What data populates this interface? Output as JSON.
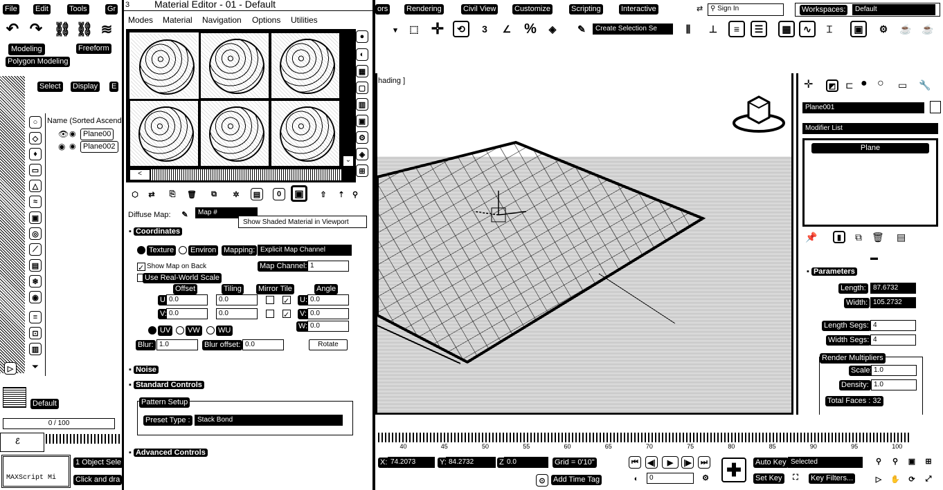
{
  "menubar": {
    "left_items": [
      "File",
      "Edit",
      "Tools",
      "Gr"
    ],
    "right_items": [
      "ors",
      "Rendering",
      "Civil View",
      "Customize",
      "Scripting",
      "Interactive"
    ],
    "sign_in": "Sign In",
    "workspaces_label": "Workspaces:",
    "workspace_value": "Default"
  },
  "ribbon": {
    "tabs": [
      "Modeling",
      "Freeform"
    ],
    "sub_label": "Polygon Modeling"
  },
  "toolbar": {
    "selection_set": "Create Selection Se"
  },
  "scene_explorer": {
    "tabs": [
      "Select",
      "Display"
    ],
    "column_header": "Name (Sorted Ascend",
    "items": [
      "Plane00",
      "Plane002"
    ],
    "layer": "Default",
    "frame_field": "0 / 100"
  },
  "material_editor": {
    "title": "Material Editor - 01 - Default",
    "title_prefix": "3",
    "menu": [
      "Modes",
      "Material",
      "Navigation",
      "Options",
      "Utilities"
    ],
    "diffuse_label": "Diffuse Map:",
    "map_name": "Map #",
    "tooltip": "Show Shaded Material in Viewport",
    "sections": {
      "coordinates": "Coordinates",
      "noise": "Noise",
      "standard_controls": "Standard Controls",
      "advanced_controls": "Advanced Controls"
    },
    "coords": {
      "texture": "Texture",
      "environ": "Environ",
      "mapping_label": "Mapping:",
      "mapping_value": "Explicit Map Channel",
      "show_map_on_back": "Show Map on Back",
      "map_channel_label": "Map Channel:",
      "map_channel_value": "1",
      "real_world": "Use Real-World Scale",
      "headers": [
        "Offset",
        "Tiling",
        "Mirror Tile",
        "Angle"
      ],
      "u_label": "U:",
      "v_label": "V:",
      "w_label": "W:",
      "offset_u": "0.0",
      "offset_v": "0.0",
      "tiling_u": "0.0",
      "tiling_v": "0.0",
      "angle_u": "0.0",
      "angle_v": "0.0",
      "angle_w": "0.0",
      "uv": "UV",
      "vw": "VW",
      "wu": "WU",
      "blur_label": "Blur:",
      "blur_value": "1.0",
      "blur_offset_label": "Blur offset:",
      "blur_offset_value": "0.0",
      "rotate": "Rotate"
    },
    "pattern_setup": "Pattern Setup",
    "preset_label": "Preset Type :",
    "preset_value": "Stack Bond"
  },
  "viewport": {
    "label": "hading ]"
  },
  "command_panel": {
    "object_name": "Plane001",
    "modifier_list": "Modifier List",
    "stack_item": "Plane",
    "parameters": "Parameters",
    "length_label": "Length:",
    "length_value": "87.6732",
    "width_label": "Width:",
    "width_value": "105.2732",
    "length_segs_label": "Length Segs:",
    "length_segs_value": "4",
    "width_segs_label": "Width Segs:",
    "width_segs_value": "4",
    "render_multipliers": "Render Multipliers",
    "scale_label": "Scale:",
    "scale_value": "1.0",
    "density_label": "Density:",
    "density_value": "1.0",
    "total_faces": "Total Faces : 32"
  },
  "timeline": {
    "ticks": [
      "40",
      "45",
      "50",
      "55",
      "60",
      "65",
      "70",
      "75",
      "80",
      "85",
      "90",
      "95",
      "100"
    ]
  },
  "status": {
    "maxscript": "MAXScript Mi",
    "prompt1": "1 Object Sele",
    "prompt2": "Click and dra",
    "x_label": "X:",
    "x_value": "74.2073",
    "y_label": "Y:",
    "y_value": "84.2732",
    "z_label": "Z:",
    "z_value": "0.0",
    "grid": "Grid = 0'10\"",
    "add_time_tag": "Add Time Tag",
    "frame": "0",
    "auto_key": "Auto Key",
    "set_key": "Set Key",
    "selected": "Selected",
    "key_filters": "Key Filters..."
  }
}
